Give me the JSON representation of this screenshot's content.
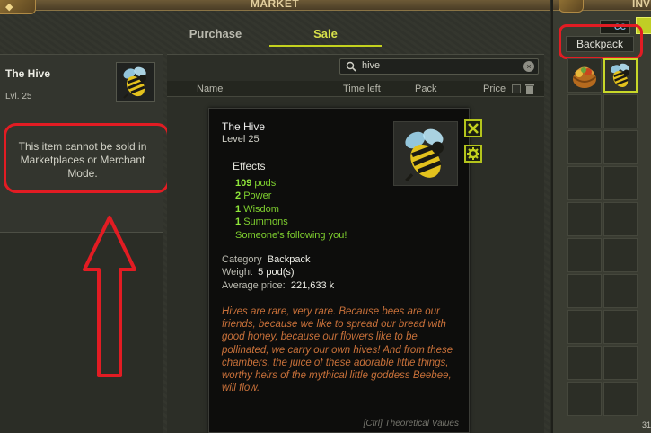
{
  "market": {
    "title": "MARKET",
    "tabs": [
      {
        "label": "Purchase",
        "active": false
      },
      {
        "label": "Sale",
        "active": true
      }
    ],
    "selected_item": {
      "name": "The Hive",
      "level": "Lvl. 25",
      "icon": "bee-icon",
      "message": "This item cannot be sold in Marketplaces or Merchant Mode."
    },
    "search": {
      "value": "hive"
    },
    "columns": [
      "Name",
      "Time left",
      "Pack",
      "Price"
    ]
  },
  "tooltip": {
    "name": "The Hive",
    "level": "Level  25",
    "effects_title": "Effects",
    "effects": [
      {
        "value": "109",
        "label": "pods"
      },
      {
        "value": "2",
        "label": "Power"
      },
      {
        "value": "1",
        "label": "Wisdom"
      },
      {
        "value": "1",
        "label": "Summons"
      }
    ],
    "effect_extra": "Someone's following you!",
    "category_label": "Category",
    "category": "Backpack",
    "weight_label": "Weight",
    "weight": "5 pod(s)",
    "avg_price_label": "Average price:",
    "avg_price": "221,633 k",
    "description": "Hives are rare, very rare. Because bees are our friends, because we like to spread our bread with good honey, because our flowers like to be pollinated, we carry our own hives! And from these chambers, the juice of these adorable little things, worthy heirs of the mythical little goddess Beebee, will flow.",
    "footer": "[Ctrl] Theoretical Values"
  },
  "inventory": {
    "title": "INV",
    "cc_tab": "CC",
    "backpack_label": "Backpack",
    "slot_count": "31",
    "items": [
      {
        "icon": "honey-basket-icon",
        "selected": false
      },
      {
        "icon": "bee-icon",
        "selected": true
      }
    ]
  },
  "colors": {
    "annotation": "#e21c23",
    "active_tab": "#d7e04a",
    "effect_green": "#7fd02f",
    "description_orange": "#c9713a"
  }
}
